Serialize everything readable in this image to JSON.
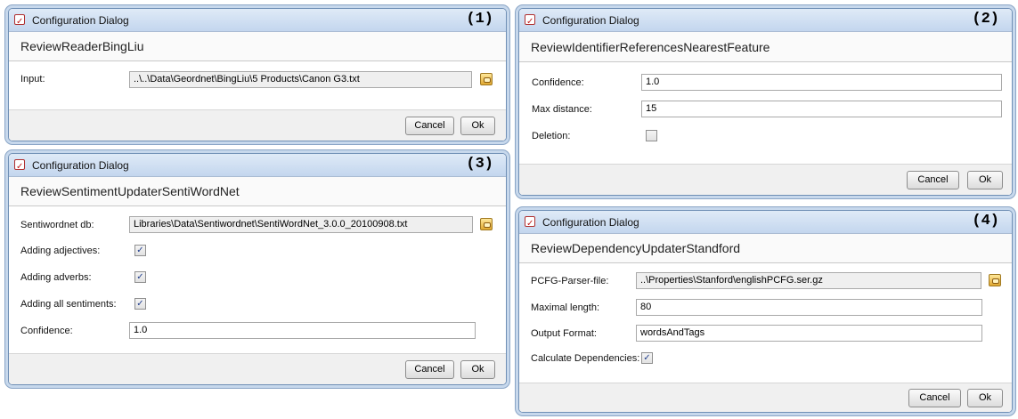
{
  "dialogs": [
    {
      "title": "Configuration Dialog",
      "tag": "(1)",
      "header": "ReviewReaderBingLiu",
      "input_label": "Input:",
      "input_value": "..\\..\\Data\\Geordnet\\BingLiu\\5 Products\\Canon G3.txt",
      "cancel": "Cancel",
      "ok": "Ok"
    },
    {
      "title": "Configuration Dialog",
      "tag": "(2)",
      "header": "ReviewIdentifierReferencesNearestFeature",
      "confidence_label": "Confidence:",
      "confidence_value": "1.0",
      "maxdist_label": "Max distance:",
      "maxdist_value": "15",
      "deletion_label": "Deletion:",
      "deletion_checked": false,
      "cancel": "Cancel",
      "ok": "Ok"
    },
    {
      "title": "Configuration Dialog",
      "tag": "(3)",
      "header": "ReviewSentimentUpdaterSentiWordNet",
      "db_label": "Sentiwordnet db:",
      "db_value": "Libraries\\Data\\Sentiwordnet\\SentiWordNet_3.0.0_20100908.txt",
      "adj_label": "Adding adjectives:",
      "adj_checked": true,
      "adv_label": "Adding adverbs:",
      "adv_checked": true,
      "all_label": "Adding all sentiments:",
      "all_checked": true,
      "confidence_label": "Confidence:",
      "confidence_value": "1.0",
      "cancel": "Cancel",
      "ok": "Ok"
    },
    {
      "title": "Configuration Dialog",
      "tag": "(4)",
      "header": "ReviewDependencyUpdaterStandford",
      "pcfg_label": "PCFG-Parser-file:",
      "pcfg_value": "..\\Properties\\Stanford\\englishPCFG.ser.gz",
      "maxlen_label": "Maximal length:",
      "maxlen_value": "80",
      "format_label": "Output Format:",
      "format_value": "wordsAndTags",
      "calc_label": "Calculate Dependencies:",
      "calc_checked": true,
      "cancel": "Cancel",
      "ok": "Ok"
    }
  ],
  "check_glyph": "✓"
}
